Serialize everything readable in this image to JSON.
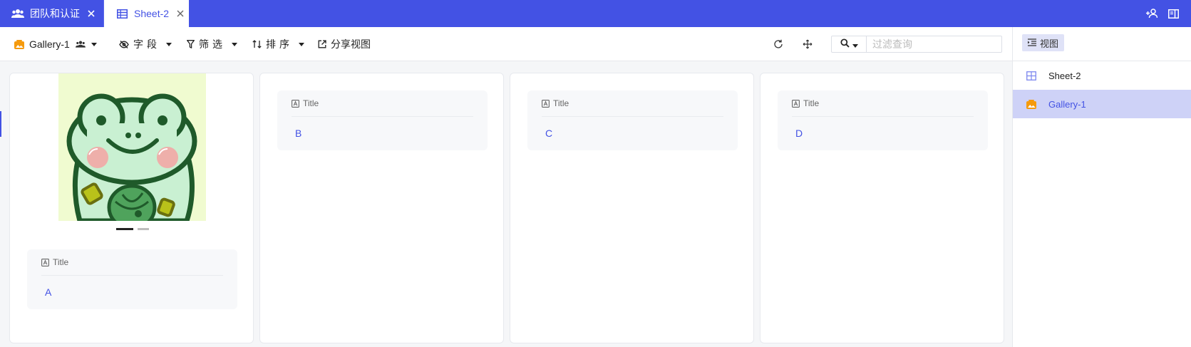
{
  "tabs": [
    {
      "label": "团队和认证",
      "icon": "team-icon"
    },
    {
      "label": "Sheet-2",
      "icon": "table-grid-icon",
      "active": true
    }
  ],
  "toolbar": {
    "view_label": "Gallery-1",
    "fields_label": "字段",
    "filter_label": "筛选",
    "sort_label": "排序",
    "share_label": "分享视图",
    "search_placeholder": "过滤查询"
  },
  "right_panel": {
    "view_button_label": "视图",
    "views": [
      {
        "label": "Sheet-2",
        "icon": "grid-view-icon",
        "active": false
      },
      {
        "label": "Gallery-1",
        "icon": "gallery-view-icon",
        "active": true
      }
    ]
  },
  "cards": [
    {
      "field_label": "Title",
      "value": "A",
      "has_cover": true
    },
    {
      "field_label": "Title",
      "value": "B",
      "has_cover": false
    },
    {
      "field_label": "Title",
      "value": "C",
      "has_cover": false
    },
    {
      "field_label": "Title",
      "value": "D",
      "has_cover": false
    }
  ],
  "carousel": {
    "slide_count": 2,
    "active_index": 0
  },
  "colors": {
    "accent": "#4352e4",
    "gallery_icon": "#f59a0c"
  }
}
